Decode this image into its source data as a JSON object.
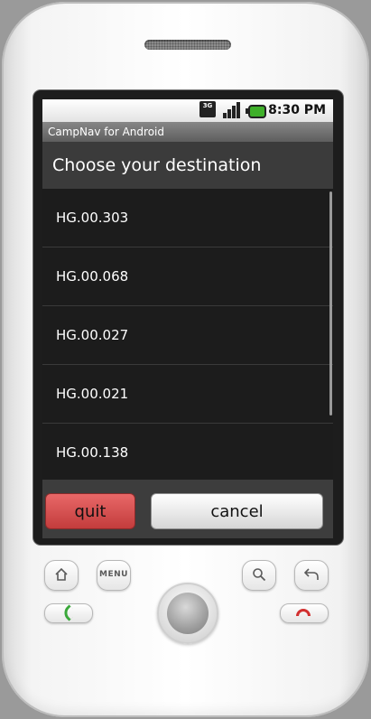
{
  "status_bar": {
    "network_badge": "3G",
    "time": "8:30 PM",
    "icons": [
      "3g-icon",
      "signal-icon",
      "battery-icon"
    ]
  },
  "app": {
    "title": "CampNav for Android"
  },
  "dialog": {
    "title": "Choose your destination",
    "items": [
      {
        "label": "HG.00.303"
      },
      {
        "label": "HG.00.068"
      },
      {
        "label": "HG.00.027"
      },
      {
        "label": "HG.00.021"
      },
      {
        "label": "HG.00.138"
      }
    ],
    "quit_label": "quit",
    "cancel_label": "cancel"
  },
  "hardware": {
    "menu_label": "MENU",
    "icons": [
      "home-icon",
      "search-icon",
      "back-icon",
      "call-icon",
      "end-call-icon"
    ]
  },
  "colors": {
    "quit_button": "#d94f4f",
    "status_bar": "#f0f0f0",
    "title_bar": "#6e6e6e",
    "list_background": "#1c1c1c"
  }
}
